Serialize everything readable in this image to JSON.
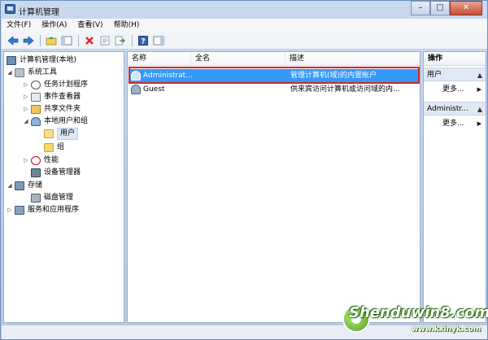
{
  "window": {
    "title": "计算机管理"
  },
  "caption_buttons": {
    "minimize": "–",
    "maximize": "□",
    "close": "✕"
  },
  "menu": [
    "文件(F)",
    "操作(A)",
    "查看(V)",
    "帮助(H)"
  ],
  "toolbar": {
    "icons": [
      "back-arrow-icon",
      "forward-arrow-icon",
      "up-folder-icon",
      "show-hide-tree-icon",
      "delete-icon",
      "properties-icon",
      "export-icon",
      "help-icon",
      "show-action-pane-icon"
    ],
    "colors": {
      "back": "#2f7bd6",
      "forward": "#2f7bd6",
      "delete": "#d62a2a",
      "help": "#3b63b3"
    }
  },
  "tree": {
    "root": "计算机管理(本地)",
    "system_tools": "系统工具",
    "task_scheduler": "任务计划程序",
    "event_viewer": "事件查看器",
    "shared_folders": "共享文件夹",
    "local_users_groups": "本地用户和组",
    "users": "用户",
    "groups": "组",
    "performance": "性能",
    "device_manager": "设备管理器",
    "storage": "存储",
    "disk_management": "磁盘管理",
    "services_apps": "服务和应用程序"
  },
  "list": {
    "columns": [
      "名称",
      "全名",
      "描述"
    ],
    "rows": [
      {
        "name": "Administrat...",
        "fullname": "",
        "description": "管理计算机(域)的内置帐户",
        "selected": true
      },
      {
        "name": "Guest",
        "fullname": "",
        "description": "供来宾访问计算机或访问域的内...",
        "selected": false
      }
    ]
  },
  "actions": {
    "title": "操作",
    "section1": "用户",
    "more1": "更多...",
    "section2": "Administr...",
    "more2": "更多..."
  },
  "watermark": {
    "brand": "Shenduwin8.com",
    "url": "www.kxinyk.com"
  },
  "colors": {
    "selection": "#3399ff",
    "highlight_box": "#d2252c",
    "title_bar": "#c8d9ee"
  }
}
